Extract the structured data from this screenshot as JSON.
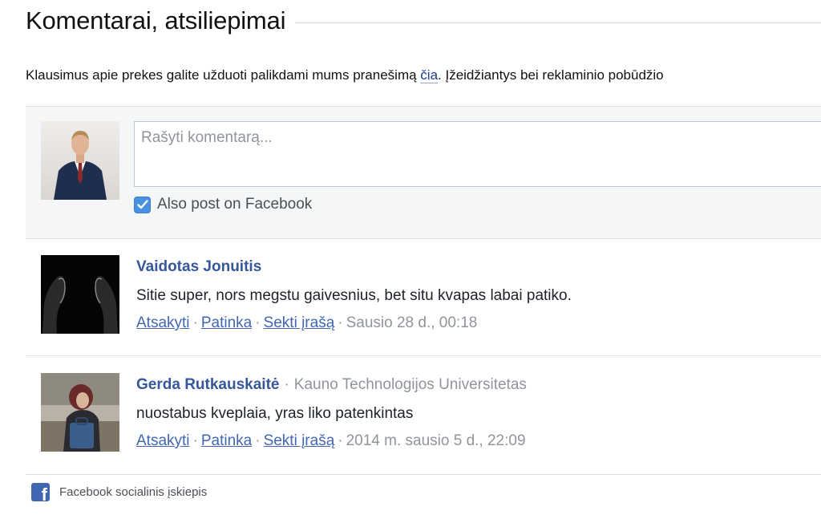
{
  "section": {
    "title": "Komentarai, atsiliepimai"
  },
  "intro": {
    "text_before": "Klausimus apie prekes galite užduoti palikdami mums pranešimą ",
    "link": "čia",
    "text_after": ". Įžeidžiantys bei reklaminio pobūdžio"
  },
  "composer": {
    "placeholder": "Rašyti komentarą...",
    "also_post_label": "Also post on Facebook",
    "also_post_checked": true
  },
  "comments": [
    {
      "author": "Vaidotas Jonuitis",
      "subtitle": "",
      "text": "Sitie super, nors megstu gaivesnius, bet situ kvapas labai patiko.",
      "reply": "Atsakyti",
      "like": "Patinka",
      "follow": "Sekti įrašą",
      "time": "Sausio 28 d., 00:18"
    },
    {
      "author": "Gerda Rutkauskaitė",
      "subtitle": "Kauno Technologijos Universitetas",
      "text": "nuostabus kveplaia, yras liko patenkintas",
      "reply": "Atsakyti",
      "like": "Patinka",
      "follow": "Sekti įrašą",
      "time": "2014 m. sausio 5 d., 22:09"
    }
  ],
  "separator": "·",
  "footer": {
    "text": "Facebook socialinis įskiepis",
    "logo_letter": "f"
  },
  "colors": {
    "link_blue": "#365899",
    "action_blue": "#4267b2",
    "meta_gray": "#90949c",
    "checkbox_blue": "#4a90e2"
  }
}
